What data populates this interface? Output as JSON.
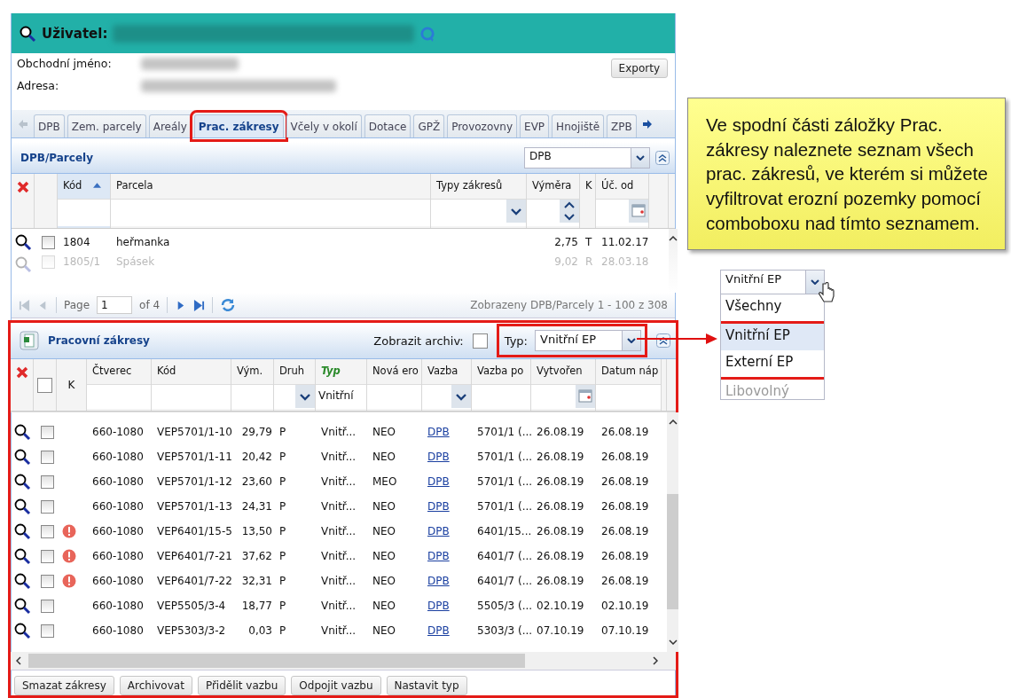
{
  "header": {
    "title": "Uživatel:"
  },
  "info": {
    "labels": [
      "Obchodní jméno:",
      "Adresa:"
    ],
    "export_button": "Exporty"
  },
  "tabs": [
    {
      "label": "DPB",
      "selected": false,
      "annotated": false
    },
    {
      "label": "Zem. parcely",
      "selected": false,
      "annotated": false
    },
    {
      "label": "Areály",
      "selected": false,
      "annotated": false
    },
    {
      "label": "Prac. zákresy",
      "selected": true,
      "annotated": true
    },
    {
      "label": "Včely v okolí",
      "selected": false,
      "annotated": false
    },
    {
      "label": "Dotace",
      "selected": false,
      "annotated": false
    },
    {
      "label": "GPŽ",
      "selected": false,
      "annotated": false
    },
    {
      "label": "Provozovny",
      "selected": false,
      "annotated": false
    },
    {
      "label": "EVP",
      "selected": false,
      "annotated": false
    },
    {
      "label": "Hnojiště",
      "selected": false,
      "annotated": false
    },
    {
      "label": "ZPB",
      "selected": false,
      "annotated": false
    }
  ],
  "parcels": {
    "title": "DPB/Parcely",
    "filter_value": "DPB",
    "columns": [
      {
        "label": "Kód",
        "kind": "text",
        "sorted": true
      },
      {
        "label": "Parcela",
        "kind": "text",
        "sorted": false
      },
      {
        "label": "Typy zákresů",
        "kind": "combo",
        "sorted": false
      },
      {
        "label": "Výměra",
        "kind": "spin",
        "sorted": false
      },
      {
        "label": "K",
        "kind": "none",
        "sorted": false
      },
      {
        "label": "Úč. od",
        "kind": "date",
        "sorted": false
      }
    ],
    "rows": [
      {
        "cells": [
          "1804",
          "heřmanka",
          "",
          "2,75",
          "T",
          "11.02.17"
        ],
        "faded": false
      },
      {
        "cells": [
          "1805/1",
          "Spásek",
          "",
          "9,02",
          "R",
          "28.03.18"
        ],
        "faded": true
      }
    ],
    "pager": {
      "page_label": "Page",
      "page": "1",
      "of": "of 4",
      "summary": "Zobrazeny DPB/Parcely 1 - 100 z 308"
    }
  },
  "works": {
    "title": "Pracovní zákresy",
    "archive_label": "Zobrazit archiv:",
    "archive_checked": false,
    "type_label": "Typ:",
    "type_value": "Vnitřní EP",
    "annotated": true,
    "select_all_checked": false,
    "flag_label": "K",
    "columns": [
      {
        "label": "Čtverec",
        "kind": "text",
        "active": false
      },
      {
        "label": "Kód",
        "kind": "text",
        "active": false
      },
      {
        "label": "Vým.",
        "kind": "text",
        "active": false
      },
      {
        "label": "Druh",
        "kind": "combo",
        "active": false
      },
      {
        "label": "Typ",
        "kind": "text",
        "active": true,
        "filter_value": "Vnitřní"
      },
      {
        "label": "Nová ero",
        "kind": "text",
        "active": false
      },
      {
        "label": "Vazba",
        "kind": "combo",
        "active": false
      },
      {
        "label": "Vazba po",
        "kind": "text",
        "active": false
      },
      {
        "label": "Vytvořen",
        "kind": "date",
        "active": false
      },
      {
        "label": "Datum náp",
        "kind": "text",
        "active": false
      }
    ],
    "rows": [
      {
        "warning": false,
        "checked": false,
        "cells": [
          "660-1080",
          "VEP5701/1-10",
          "29,79",
          "P",
          "Vnitř...",
          "NEO",
          "DPB",
          "5701/1 (...",
          "26.08.19",
          "26.08.19"
        ]
      },
      {
        "warning": false,
        "checked": false,
        "cells": [
          "660-1080",
          "VEP5701/1-11",
          "20,42",
          "P",
          "Vnitř...",
          "NEO",
          "DPB",
          "5701/1 (...",
          "26.08.19",
          "26.08.19"
        ]
      },
      {
        "warning": false,
        "checked": false,
        "cells": [
          "660-1080",
          "VEP5701/1-12",
          "23,60",
          "P",
          "Vnitř...",
          "MEO",
          "DPB",
          "5701/1 (...",
          "26.08.19",
          "26.08.19"
        ]
      },
      {
        "warning": false,
        "checked": false,
        "cells": [
          "660-1080",
          "VEP5701/1-13",
          "24,31",
          "P",
          "Vnitř...",
          "NEO",
          "DPB",
          "5701/1 (...",
          "26.08.19",
          "26.08.19"
        ]
      },
      {
        "warning": true,
        "checked": false,
        "cells": [
          "660-1080",
          "VEP6401/15-5",
          "13,50",
          "P",
          "Vnitř...",
          "NEO",
          "DPB",
          "6401/15...",
          "26.08.19",
          "26.08.19"
        ]
      },
      {
        "warning": true,
        "checked": false,
        "cells": [
          "660-1080",
          "VEP6401/7-21",
          "37,62",
          "P",
          "Vnitř...",
          "NEO",
          "DPB",
          "6401/7 (...",
          "26.08.19",
          "26.08.19"
        ]
      },
      {
        "warning": true,
        "checked": false,
        "cells": [
          "660-1080",
          "VEP6401/7-22",
          "32,31",
          "P",
          "Vnitř...",
          "NEO",
          "DPB",
          "6401/7 (...",
          "26.08.19",
          "26.08.19"
        ]
      },
      {
        "warning": false,
        "checked": false,
        "cells": [
          "660-1080",
          "VEP5505/3-4",
          "18,77",
          "P",
          "Vnitř...",
          "NEO",
          "DPB",
          "5505/3 (...",
          "02.10.19",
          "02.10.19"
        ]
      },
      {
        "warning": false,
        "checked": false,
        "cells": [
          "660-1080",
          "VEP5303/3-2",
          "0,03",
          "P",
          "Vnitř...",
          "NEO",
          "DPB",
          "5303/3 (...",
          "07.10.19",
          "07.10.19"
        ]
      }
    ],
    "buttons": [
      "Smazat zákresy",
      "Archivovat",
      "Přidělit vazbu",
      "Odpojit vazbu",
      "Nastavit typ"
    ]
  },
  "callout": {
    "text": "Ve spodní části záložky Prac. zákresy naleznete seznam všech prac. zákresů, ve kterém si můžete vyfiltrovat erozní pozemky pomocí comboboxu nad tímto seznamem."
  },
  "dropdown": {
    "value": "Vnitřní EP",
    "options": [
      {
        "label": "Všechny",
        "selected": false,
        "annotated": false,
        "faded": false
      },
      {
        "label": "Vnitřní EP",
        "selected": true,
        "annotated": true,
        "faded": false
      },
      {
        "label": "Externí EP",
        "selected": false,
        "annotated": true,
        "faded": false
      },
      {
        "label": "Libovolný",
        "selected": false,
        "annotated": false,
        "faded": true
      }
    ]
  }
}
